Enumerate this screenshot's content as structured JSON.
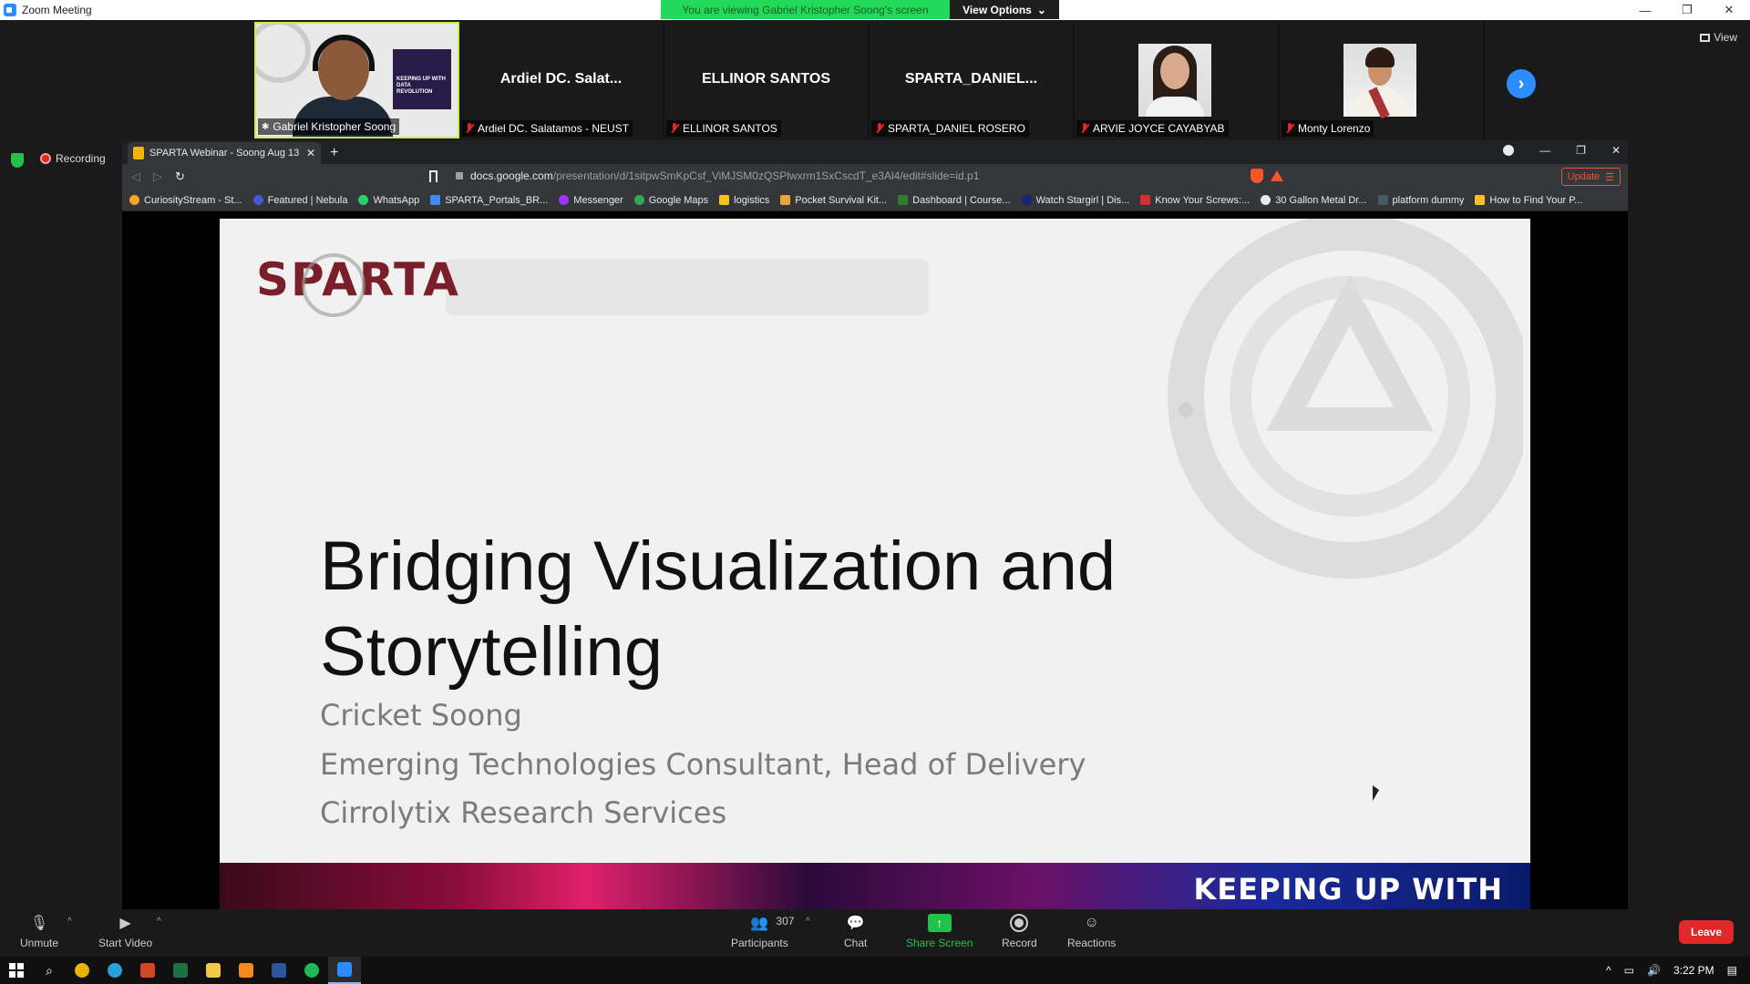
{
  "window": {
    "title": "Zoom Meeting",
    "controls": [
      "—",
      "❐",
      "✕"
    ]
  },
  "viewing_banner": {
    "message": "You are viewing Gabriel Kristopher Soong's screen",
    "options_label": "View Options"
  },
  "participants_strip": [
    {
      "big_name": "",
      "label": "Gabriel Kristopher Soong",
      "muted": false,
      "video": true
    },
    {
      "big_name": "Ardiel DC. Salat...",
      "label": "Ardiel DC. Salatamos - NEUST",
      "muted": true
    },
    {
      "big_name": "ELLINOR SANTOS",
      "label": "ELLINOR SANTOS",
      "muted": true
    },
    {
      "big_name": "SPARTA_DANIEL...",
      "label": "SPARTA_DANIEL ROSERO",
      "muted": true
    },
    {
      "big_name": "",
      "label": "ARVIE JOYCE CAYABYAB",
      "muted": true,
      "photo": true
    },
    {
      "big_name": "",
      "label": "Monty Lorenzo",
      "muted": true,
      "photo": true
    }
  ],
  "view_label": "View",
  "recording_label": "Recording",
  "browser": {
    "tab_title": "SPARTA Webinar - Soong Aug 13",
    "url_host": "docs.google.com",
    "url_path": "/presentation/d/1sitpwSmKpCsf_ViMJSM0zQSPlwxrm1SxCscdT_e3Al4/edit#slide=id.p1",
    "update_label": "Update",
    "bookmarks": [
      {
        "label": "CuriosityStream - St...",
        "color": "#f5a623"
      },
      {
        "label": "Featured | Nebula",
        "color": "#3b5bdb"
      },
      {
        "label": "WhatsApp",
        "color": "#25d366"
      },
      {
        "label": "SPARTA_Portals_BR...",
        "color": "#4285f4"
      },
      {
        "label": "Messenger",
        "color": "#a033ff"
      },
      {
        "label": "Google Maps",
        "color": "#34a853"
      },
      {
        "label": "logistics",
        "color": "#f5c518"
      },
      {
        "label": "Pocket Survival Kit...",
        "color": "#e8a33d"
      },
      {
        "label": "Dashboard | Course...",
        "color": "#2e7d32"
      },
      {
        "label": "Watch Stargirl | Dis...",
        "color": "#1a237e"
      },
      {
        "label": "Know Your Screws:...",
        "color": "#d32f2f"
      },
      {
        "label": "30 Gallon Metal Dr...",
        "color": "#e8eaed"
      },
      {
        "label": "platform dummy",
        "color": "#455a64"
      },
      {
        "label": "How to Find Your P...",
        "color": "#fbc02d"
      }
    ]
  },
  "slide": {
    "logo_text": "SPARTA",
    "title_line1": "Bridging Visualization and",
    "title_line2": "Storytelling",
    "presenter": "Cricket Soong",
    "role": "Emerging Technologies Consultant, Head of Delivery",
    "company": "Cirrolytix Research Services",
    "banner_text": "KEEPING UP WITH"
  },
  "toolbar": {
    "unmute": "Unmute",
    "start_video": "Start Video",
    "participants": "Participants",
    "participant_count": "307",
    "chat": "Chat",
    "share_screen": "Share Screen",
    "record": "Record",
    "reactions": "Reactions",
    "leave": "Leave"
  },
  "taskbar": {
    "time": "3:22 PM"
  }
}
